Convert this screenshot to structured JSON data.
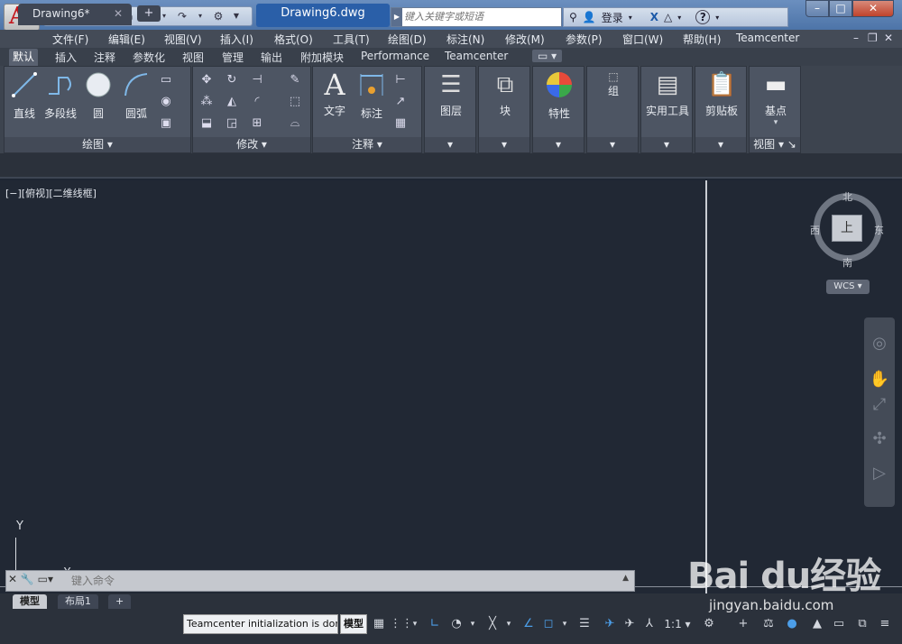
{
  "title_bar": {
    "logo_letter": "A",
    "document_title": "Drawing6.dwg",
    "search_placeholder": "键入关键字或短语",
    "login_label": "登录",
    "help_label": "?"
  },
  "menu": {
    "items": [
      "文件(F)",
      "编辑(E)",
      "视图(V)",
      "插入(I)",
      "格式(O)",
      "工具(T)",
      "绘图(D)",
      "标注(N)",
      "修改(M)",
      "参数(P)",
      "窗口(W)",
      "帮助(H)",
      "Teamcenter"
    ]
  },
  "ribbon_tabs": [
    "默认",
    "插入",
    "注释",
    "参数化",
    "视图",
    "管理",
    "输出",
    "附加模块",
    "Performance",
    "Teamcenter"
  ],
  "ribbon": {
    "draw": {
      "title": "绘图",
      "line": "直线",
      "polyline": "多段线",
      "circle": "圆",
      "arc": "圆弧"
    },
    "modify": {
      "title": "修改"
    },
    "annotation": {
      "title": "注释",
      "text": "文字",
      "dimension": "标注"
    },
    "layers": {
      "label": "图层"
    },
    "block": {
      "label": "块"
    },
    "properties": {
      "label": "特性"
    },
    "groups": {
      "label": "组"
    },
    "utilities": {
      "label": "实用工具"
    },
    "clipboard": {
      "label": "剪贴板"
    },
    "view": {
      "label": "基点",
      "title": "视图"
    }
  },
  "doc_tabs": {
    "active": "Drawing6*"
  },
  "viewport": {
    "label": "[−][俯视][二维线框]"
  },
  "viewcube": {
    "north": "北",
    "south": "南",
    "east": "东",
    "west": "西",
    "face": "上",
    "wcs": "WCS"
  },
  "ucs": {
    "y": "Y",
    "x": "X"
  },
  "command_line": {
    "placeholder": "键入命令"
  },
  "layout_tabs": [
    "模型",
    "布局1"
  ],
  "status_bar": {
    "message": "Teamcenter initialization is done",
    "model": "模型",
    "scale": "1:1"
  },
  "watermark": {
    "brand": "Bai du经验",
    "url": "jingyan.baidu.com"
  }
}
